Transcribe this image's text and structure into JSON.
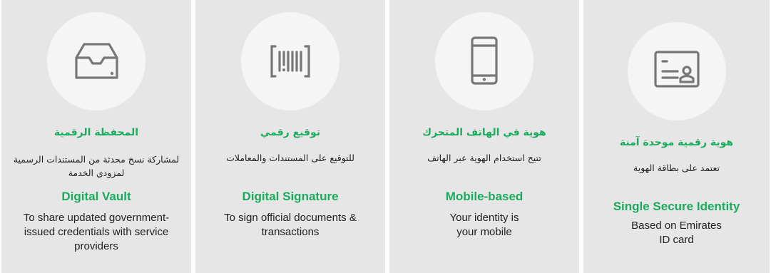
{
  "cards": [
    {
      "icon": "inbox-tray-icon",
      "ar_title": "المحفظة الرقمية",
      "ar_desc": "لمشاركة نسخ محدثة من المستندات الرسمية لمزودي الخدمة",
      "en_title": "Digital Vault",
      "en_desc": "To share updated government-issued credentials with service providers"
    },
    {
      "icon": "barcode-scan-icon",
      "ar_title": "توقيع رقمي",
      "ar_desc": "للتوقيع على المستندات والمعاملات",
      "en_title": "Digital Signature",
      "en_desc": "To sign official documents & transactions"
    },
    {
      "icon": "mobile-phone-icon",
      "ar_title": "هوية في الهاتف المتحرك",
      "ar_desc": "تتيح استخدام الهوية عبر الهاتف",
      "en_title": "Mobile-based",
      "en_desc": "Your identity is your mobile"
    },
    {
      "icon": "id-card-icon",
      "ar_title": "هوية رقمية موحدة آمنة",
      "ar_desc": "تعتمد على بطاقة الهوية",
      "en_title": "Single Secure Identity",
      "en_desc": "Based on Emirates ID card"
    }
  ],
  "colors": {
    "accent": "#1aab5c",
    "card_bg": "#e6e6e6",
    "circle_bg": "#f5f5f5",
    "icon_stroke": "#777777"
  }
}
